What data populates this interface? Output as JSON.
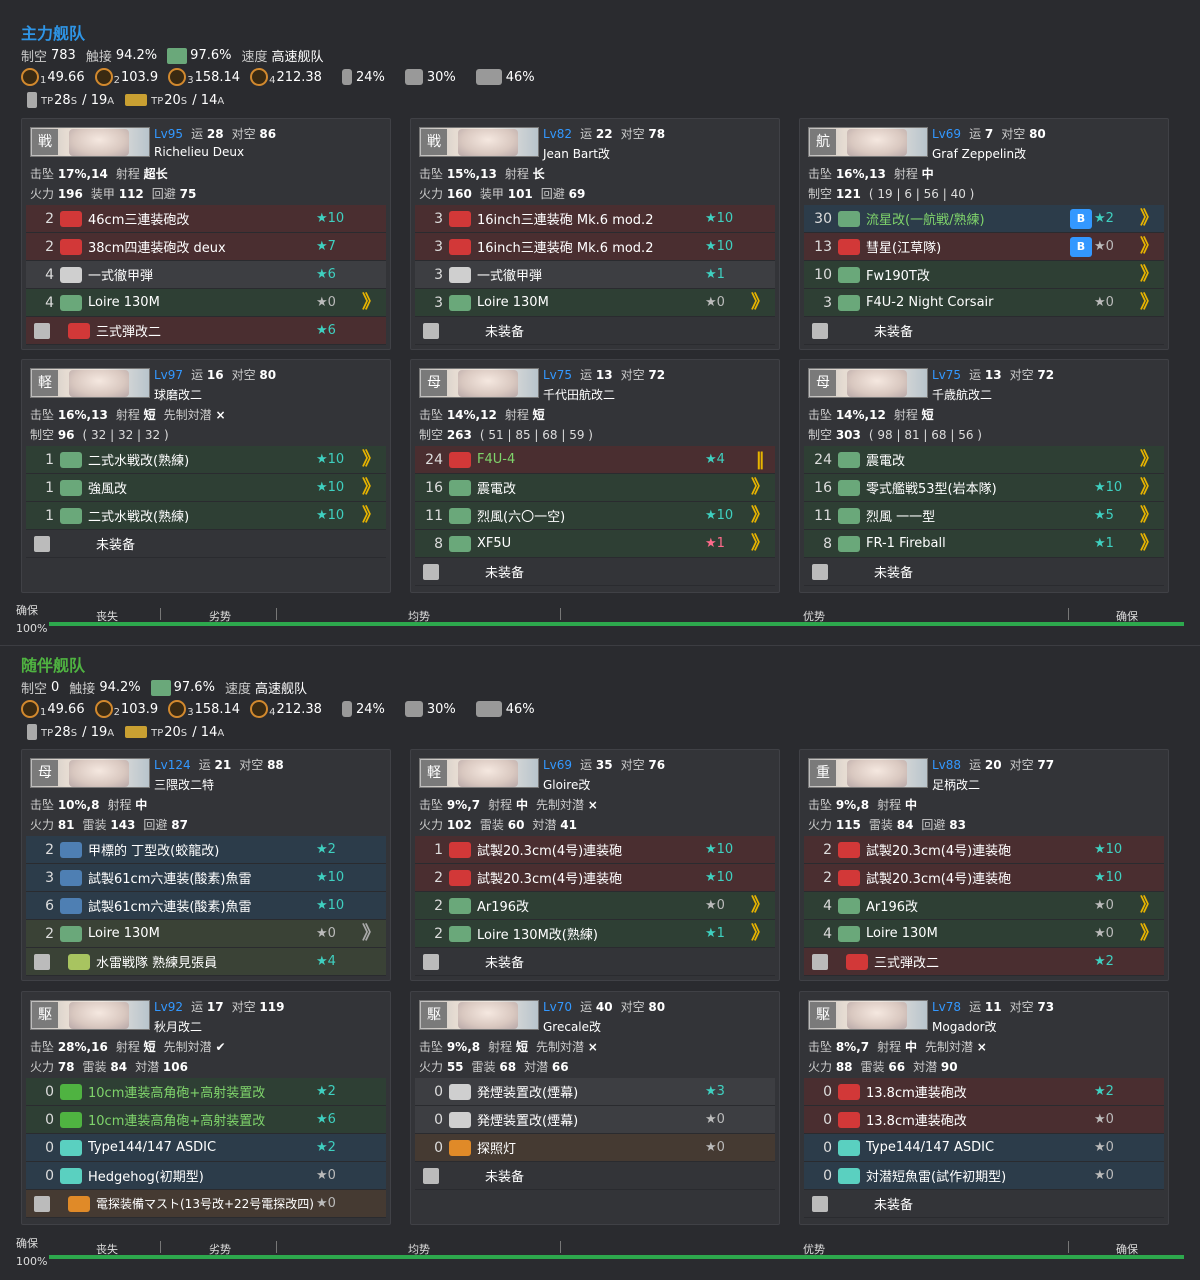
{
  "fleets": [
    {
      "title": "主力舰队",
      "stats": {
        "air_label": "制空",
        "air_value": "783",
        "contact_label": "触接",
        "contact_value": "94.2%",
        "contact_night_value": "97.6%",
        "speed_label": "速度",
        "speed_value": "高速舰队"
      },
      "los": [
        {
          "sub": "1",
          "value": "49.66"
        },
        {
          "sub": "2",
          "value": "103.9"
        },
        {
          "sub": "3",
          "value": "158.14"
        },
        {
          "sub": "4",
          "value": "212.38"
        }
      ],
      "smoke": [
        "24%",
        "30%",
        "46%"
      ],
      "tp": {
        "drum_s": "28",
        "drum_a": "19",
        "tank_s": "20",
        "tank_a": "14",
        "tp_label": "TP",
        "s": "S",
        "a": "A"
      },
      "air_state": {
        "pct": "100%",
        "labels": [
          "确保",
          "丧失",
          "劣势",
          "均势",
          "优势",
          "确保"
        ]
      }
    },
    {
      "title": "随伴舰队",
      "stats": {
        "air_label": "制空",
        "air_value": "0",
        "contact_label": "触接",
        "contact_value": "94.2%",
        "contact_night_value": "97.6%",
        "speed_label": "速度",
        "speed_value": "高速舰队"
      },
      "los": [
        {
          "sub": "1",
          "value": "49.66"
        },
        {
          "sub": "2",
          "value": "103.9"
        },
        {
          "sub": "3",
          "value": "158.14"
        },
        {
          "sub": "4",
          "value": "212.38"
        }
      ],
      "smoke": [
        "24%",
        "30%",
        "46%"
      ],
      "tp": {
        "drum_s": "28",
        "drum_a": "19",
        "tank_s": "20",
        "tank_a": "14",
        "tp_label": "TP",
        "s": "S",
        "a": "A"
      },
      "air_state": {
        "pct": "100%",
        "labels": [
          "确保",
          "丧失",
          "劣势",
          "均势",
          "优势",
          "确保"
        ]
      }
    }
  ],
  "ships": [
    {
      "type": "戦",
      "lv": "Lv95",
      "luck_label": "运",
      "luck": "28",
      "aa_label": "对空",
      "aa": "86",
      "name": "Richelieu Deux",
      "r1": [
        [
          "击坠",
          "17%,14"
        ],
        [
          "射程",
          "超长"
        ]
      ],
      "r2": [
        [
          "火力",
          "196"
        ],
        [
          "装甲",
          "112"
        ],
        [
          "回避",
          "75"
        ]
      ],
      "slots": [
        {
          "bg": "red",
          "cnt": "2",
          "icon": "red",
          "name": "46cm三連装砲改",
          "star": "★10",
          "sc": "",
          "prof": ""
        },
        {
          "bg": "red",
          "cnt": "2",
          "icon": "red",
          "name": "38cm四連装砲改 deux",
          "star": "★7",
          "sc": "",
          "prof": ""
        },
        {
          "bg": "gray",
          "cnt": "4",
          "icon": "gray",
          "name": "一式徹甲弾",
          "star": "★6",
          "sc": "",
          "prof": ""
        },
        {
          "bg": "green",
          "cnt": "4",
          "icon": "green",
          "name": "Loire 130M",
          "star": "★0",
          "sc": "grey",
          "prof": "》"
        },
        {
          "bg": "red",
          "cnt": "",
          "icon": "red",
          "name": "三式弾改二",
          "star": "★6",
          "sc": "",
          "prof": "",
          "wrench": true
        }
      ]
    },
    {
      "type": "戦",
      "lv": "Lv82",
      "luck_label": "运",
      "luck": "22",
      "aa_label": "对空",
      "aa": "78",
      "name": "Jean Bart改",
      "r1": [
        [
          "击坠",
          "15%,13"
        ],
        [
          "射程",
          "长"
        ]
      ],
      "r2": [
        [
          "火力",
          "160"
        ],
        [
          "装甲",
          "101"
        ],
        [
          "回避",
          "69"
        ]
      ],
      "slots": [
        {
          "bg": "red",
          "cnt": "3",
          "icon": "red",
          "name": "16inch三連装砲 Mk.6 mod.2",
          "star": "★10",
          "sc": "",
          "prof": ""
        },
        {
          "bg": "red",
          "cnt": "3",
          "icon": "red",
          "name": "16inch三連装砲 Mk.6 mod.2",
          "star": "★10",
          "sc": "",
          "prof": ""
        },
        {
          "bg": "gray",
          "cnt": "3",
          "icon": "gray",
          "name": "一式徹甲弾",
          "star": "★1",
          "sc": "",
          "prof": ""
        },
        {
          "bg": "green",
          "cnt": "3",
          "icon": "green",
          "name": "Loire 130M",
          "star": "★0",
          "sc": "grey",
          "prof": "》"
        },
        {
          "bg": "empty",
          "cnt": "",
          "icon": "",
          "name": "未装备",
          "star": "",
          "sc": "",
          "prof": "",
          "wrench": true
        }
      ]
    },
    {
      "type": "航",
      "lv": "Lv69",
      "luck_label": "运",
      "luck": "7",
      "aa_label": "对空",
      "aa": "80",
      "name": "Graf Zeppelin改",
      "r1": [
        [
          "击坠",
          "16%,13"
        ],
        [
          "射程",
          "中"
        ]
      ],
      "r2": [
        [
          "制空",
          "121"
        ]
      ],
      "r2x": "( 19 | 6 | 56 | 40 )",
      "slots": [
        {
          "bg": "blue",
          "cnt": "30",
          "icon": "green",
          "name": "流星改(一航戦/熟練)",
          "gr": true,
          "badge": "B",
          "star": "★2",
          "sc": "",
          "prof": "》"
        },
        {
          "bg": "red",
          "cnt": "13",
          "icon": "red",
          "name": "彗星(江草隊)",
          "badge": "B",
          "star": "★0",
          "sc": "grey",
          "prof": "》"
        },
        {
          "bg": "green",
          "cnt": "10",
          "icon": "green",
          "name": "Fw190T改",
          "star": "",
          "sc": "",
          "prof": "》"
        },
        {
          "bg": "green",
          "cnt": "3",
          "icon": "green",
          "name": "F4U-2 Night Corsair",
          "star": "★0",
          "sc": "grey",
          "prof": "》"
        },
        {
          "bg": "empty",
          "cnt": "",
          "icon": "",
          "name": "未装备",
          "star": "",
          "sc": "",
          "prof": "",
          "wrench": true
        }
      ]
    },
    {
      "type": "軽",
      "lv": "Lv97",
      "luck_label": "运",
      "luck": "16",
      "aa_label": "对空",
      "aa": "80",
      "name": "球磨改二",
      "r1": [
        [
          "击坠",
          "16%,13"
        ],
        [
          "射程",
          "短"
        ],
        [
          "先制対潜",
          "×"
        ]
      ],
      "r2": [
        [
          "制空",
          "96"
        ]
      ],
      "r2x": "( 32 | 32 | 32 )",
      "slots": [
        {
          "bg": "green",
          "cnt": "1",
          "icon": "green",
          "name": "二式水戦改(熟練)",
          "star": "★10",
          "sc": "",
          "prof": "》"
        },
        {
          "bg": "green",
          "cnt": "1",
          "icon": "green",
          "name": "強風改",
          "star": "★10",
          "sc": "",
          "prof": "》"
        },
        {
          "bg": "green",
          "cnt": "1",
          "icon": "green",
          "name": "二式水戦改(熟練)",
          "star": "★10",
          "sc": "",
          "prof": "》"
        },
        {
          "bg": "empty",
          "cnt": "",
          "icon": "",
          "name": "未装备",
          "star": "",
          "sc": "",
          "prof": "",
          "wrench": true
        }
      ]
    },
    {
      "type": "母",
      "lv": "Lv75",
      "luck_label": "运",
      "luck": "13",
      "aa_label": "对空",
      "aa": "72",
      "name": "千代田航改二",
      "r1": [
        [
          "击坠",
          "14%,12"
        ],
        [
          "射程",
          "短"
        ]
      ],
      "r2": [
        [
          "制空",
          "263"
        ]
      ],
      "r2x": "( 51 | 85 | 68 | 59 )",
      "slots": [
        {
          "bg": "red",
          "cnt": "24",
          "icon": "red",
          "name": "F4U-4",
          "gr": true,
          "star": "★4",
          "sc": "",
          "prof": "‖"
        },
        {
          "bg": "green",
          "cnt": "16",
          "icon": "green",
          "name": "震電改",
          "star": "",
          "sc": "",
          "prof": "》"
        },
        {
          "bg": "green",
          "cnt": "11",
          "icon": "green",
          "name": "烈風(六〇一空)",
          "star": "★10",
          "sc": "",
          "prof": "》"
        },
        {
          "bg": "green",
          "cnt": "8",
          "icon": "green",
          "name": "XF5U",
          "star": "★1",
          "sc": "pink",
          "prof": "》"
        },
        {
          "bg": "empty",
          "cnt": "",
          "icon": "",
          "name": "未装备",
          "star": "",
          "sc": "",
          "prof": "",
          "wrench": true
        }
      ]
    },
    {
      "type": "母",
      "lv": "Lv75",
      "luck_label": "运",
      "luck": "13",
      "aa_label": "对空",
      "aa": "72",
      "name": "千歳航改二",
      "r1": [
        [
          "击坠",
          "14%,12"
        ],
        [
          "射程",
          "短"
        ]
      ],
      "r2": [
        [
          "制空",
          "303"
        ]
      ],
      "r2x": "( 98 | 81 | 68 | 56 )",
      "slots": [
        {
          "bg": "green",
          "cnt": "24",
          "icon": "green",
          "name": "震電改",
          "star": "",
          "sc": "",
          "prof": "》"
        },
        {
          "bg": "green",
          "cnt": "16",
          "icon": "green",
          "name": "零式艦戦53型(岩本隊)",
          "star": "★10",
          "sc": "",
          "prof": "》"
        },
        {
          "bg": "green",
          "cnt": "11",
          "icon": "green",
          "name": "烈風 一一型",
          "star": "★5",
          "sc": "",
          "prof": "》"
        },
        {
          "bg": "green",
          "cnt": "8",
          "icon": "green",
          "name": "FR-1 Fireball",
          "star": "★1",
          "sc": "",
          "prof": "》"
        },
        {
          "bg": "empty",
          "cnt": "",
          "icon": "",
          "name": "未装备",
          "star": "",
          "sc": "",
          "prof": "",
          "wrench": true
        }
      ]
    },
    {
      "type": "母",
      "lv": "Lv124",
      "luck_label": "运",
      "luck": "21",
      "aa_label": "对空",
      "aa": "88",
      "name": "三隈改二特",
      "r1": [
        [
          "击坠",
          "10%,8"
        ],
        [
          "射程",
          "中"
        ]
      ],
      "r2": [
        [
          "火力",
          "81"
        ],
        [
          "雷装",
          "143"
        ],
        [
          "回避",
          "87"
        ]
      ],
      "slots": [
        {
          "bg": "blue",
          "cnt": "2",
          "icon": "blue",
          "name": "甲標的 丁型改(蛟龍改)",
          "star": "★2",
          "sc": "",
          "prof": ""
        },
        {
          "bg": "blue",
          "cnt": "3",
          "icon": "blue",
          "name": "試製61cm六連装(酸素)魚雷",
          "star": "★10",
          "sc": "",
          "prof": ""
        },
        {
          "bg": "blue",
          "cnt": "6",
          "icon": "blue",
          "name": "試製61cm六連装(酸素)魚雷",
          "star": "★10",
          "sc": "",
          "prof": ""
        },
        {
          "bg": "olive",
          "cnt": "2",
          "icon": "green",
          "name": "Loire 130M",
          "star": "★0",
          "sc": "grey",
          "prof": "》",
          "pg": true
        },
        {
          "bg": "olive",
          "cnt": "",
          "icon": "olive",
          "name": "水雷戦隊 熟練見張員",
          "star": "★4",
          "sc": "",
          "prof": "",
          "wrench": true
        }
      ]
    },
    {
      "type": "軽",
      "lv": "Lv69",
      "luck_label": "运",
      "luck": "35",
      "aa_label": "对空",
      "aa": "76",
      "name": "Gloire改",
      "r1": [
        [
          "击坠",
          "9%,7"
        ],
        [
          "射程",
          "中"
        ],
        [
          "先制対潜",
          "×"
        ]
      ],
      "r2": [
        [
          "火力",
          "102"
        ],
        [
          "雷装",
          "60"
        ],
        [
          "対潜",
          "41"
        ]
      ],
      "slots": [
        {
          "bg": "red",
          "cnt": "1",
          "icon": "red",
          "name": "試製20.3cm(4号)連装砲",
          "star": "★10",
          "sc": "",
          "prof": ""
        },
        {
          "bg": "red",
          "cnt": "2",
          "icon": "red",
          "name": "試製20.3cm(4号)連装砲",
          "star": "★10",
          "sc": "",
          "prof": ""
        },
        {
          "bg": "green",
          "cnt": "2",
          "icon": "green",
          "name": "Ar196改",
          "star": "★0",
          "sc": "grey",
          "prof": "》"
        },
        {
          "bg": "green",
          "cnt": "2",
          "icon": "green",
          "name": "Loire 130M改(熟練)",
          "star": "★1",
          "sc": "",
          "prof": "》"
        },
        {
          "bg": "empty",
          "cnt": "",
          "icon": "",
          "name": "未装备",
          "star": "",
          "sc": "",
          "prof": "",
          "wrench": true
        }
      ]
    },
    {
      "type": "重",
      "lv": "Lv88",
      "luck_label": "运",
      "luck": "20",
      "aa_label": "对空",
      "aa": "77",
      "name": "足柄改二",
      "r1": [
        [
          "击坠",
          "9%,8"
        ],
        [
          "射程",
          "中"
        ]
      ],
      "r2": [
        [
          "火力",
          "115"
        ],
        [
          "雷装",
          "84"
        ],
        [
          "回避",
          "83"
        ]
      ],
      "slots": [
        {
          "bg": "red",
          "cnt": "2",
          "icon": "red",
          "name": "試製20.3cm(4号)連装砲",
          "star": "★10",
          "sc": "",
          "prof": ""
        },
        {
          "bg": "red",
          "cnt": "2",
          "icon": "red",
          "name": "試製20.3cm(4号)連装砲",
          "star": "★10",
          "sc": "",
          "prof": ""
        },
        {
          "bg": "green",
          "cnt": "4",
          "icon": "green",
          "name": "Ar196改",
          "star": "★0",
          "sc": "grey",
          "prof": "》"
        },
        {
          "bg": "green",
          "cnt": "4",
          "icon": "green",
          "name": "Loire 130M",
          "star": "★0",
          "sc": "grey",
          "prof": "》"
        },
        {
          "bg": "red",
          "cnt": "",
          "icon": "red",
          "name": "三式弾改二",
          "star": "★2",
          "sc": "",
          "prof": "",
          "wrench": true
        }
      ]
    },
    {
      "type": "駆",
      "lv": "Lv92",
      "luck_label": "运",
      "luck": "17",
      "aa_label": "对空",
      "aa": "119",
      "name": "秋月改二",
      "r1": [
        [
          "击坠",
          "28%,16"
        ],
        [
          "射程",
          "短"
        ],
        [
          "先制対潜",
          "✔"
        ]
      ],
      "r2": [
        [
          "火力",
          "78"
        ],
        [
          "雷装",
          "84"
        ],
        [
          "対潜",
          "106"
        ]
      ],
      "slots": [
        {
          "bg": "green",
          "cnt": "0",
          "icon": "lgreen",
          "name": "10cm連装高角砲+高射装置改",
          "gr": true,
          "star": "★2",
          "sc": "",
          "prof": ""
        },
        {
          "bg": "green",
          "cnt": "0",
          "icon": "lgreen",
          "name": "10cm連装高角砲+高射装置改",
          "gr": true,
          "star": "★6",
          "sc": "",
          "prof": ""
        },
        {
          "bg": "blue",
          "cnt": "0",
          "icon": "teal",
          "name": "Type144/147 ASDIC",
          "star": "★2",
          "sc": "",
          "prof": ""
        },
        {
          "bg": "blue",
          "cnt": "0",
          "icon": "teal",
          "name": "Hedgehog(初期型)",
          "star": "★0",
          "sc": "grey",
          "prof": ""
        },
        {
          "bg": "brown",
          "cnt": "",
          "icon": "orange",
          "name": "電探装備マスト(13号改+22号電探改四)",
          "sm": true,
          "star": "★0",
          "sc": "grey",
          "prof": "",
          "wrench": true
        }
      ]
    },
    {
      "type": "駆",
      "lv": "Lv70",
      "luck_label": "运",
      "luck": "40",
      "aa_label": "对空",
      "aa": "80",
      "name": "Grecale改",
      "r1": [
        [
          "击坠",
          "9%,8"
        ],
        [
          "射程",
          "短"
        ],
        [
          "先制対潜",
          "×"
        ]
      ],
      "r2": [
        [
          "火力",
          "55"
        ],
        [
          "雷装",
          "68"
        ],
        [
          "対潜",
          "66"
        ]
      ],
      "slots": [
        {
          "bg": "gray",
          "cnt": "0",
          "icon": "gray",
          "name": "発煙装置改(煙幕)",
          "star": "★3",
          "sc": "",
          "prof": ""
        },
        {
          "bg": "gray",
          "cnt": "0",
          "icon": "gray",
          "name": "発煙装置改(煙幕)",
          "star": "★0",
          "sc": "grey",
          "prof": ""
        },
        {
          "bg": "brown",
          "cnt": "0",
          "icon": "orange",
          "name": "探照灯",
          "star": "★0",
          "sc": "grey",
          "prof": ""
        },
        {
          "bg": "empty",
          "cnt": "",
          "icon": "",
          "name": "未装备",
          "star": "",
          "sc": "",
          "prof": "",
          "wrench": true
        }
      ]
    },
    {
      "type": "駆",
      "lv": "Lv78",
      "luck_label": "运",
      "luck": "11",
      "aa_label": "对空",
      "aa": "73",
      "name": "Mogador改",
      "r1": [
        [
          "击坠",
          "8%,7"
        ],
        [
          "射程",
          "中"
        ],
        [
          "先制対潜",
          "×"
        ]
      ],
      "r2": [
        [
          "火力",
          "88"
        ],
        [
          "雷装",
          "66"
        ],
        [
          "対潜",
          "90"
        ]
      ],
      "slots": [
        {
          "bg": "red",
          "cnt": "0",
          "icon": "red",
          "name": "13.8cm連装砲改",
          "star": "★2",
          "sc": "",
          "prof": ""
        },
        {
          "bg": "red",
          "cnt": "0",
          "icon": "red",
          "name": "13.8cm連装砲改",
          "star": "★0",
          "sc": "grey",
          "prof": ""
        },
        {
          "bg": "blue",
          "cnt": "0",
          "icon": "teal",
          "name": "Type144/147 ASDIC",
          "star": "★0",
          "sc": "grey",
          "prof": ""
        },
        {
          "bg": "blue",
          "cnt": "0",
          "icon": "teal",
          "name": "対潜短魚雷(試作初期型)",
          "star": "★0",
          "sc": "grey",
          "prof": ""
        },
        {
          "bg": "empty",
          "cnt": "",
          "icon": "",
          "name": "未装备",
          "star": "",
          "sc": "",
          "prof": "",
          "wrench": true
        }
      ]
    }
  ]
}
